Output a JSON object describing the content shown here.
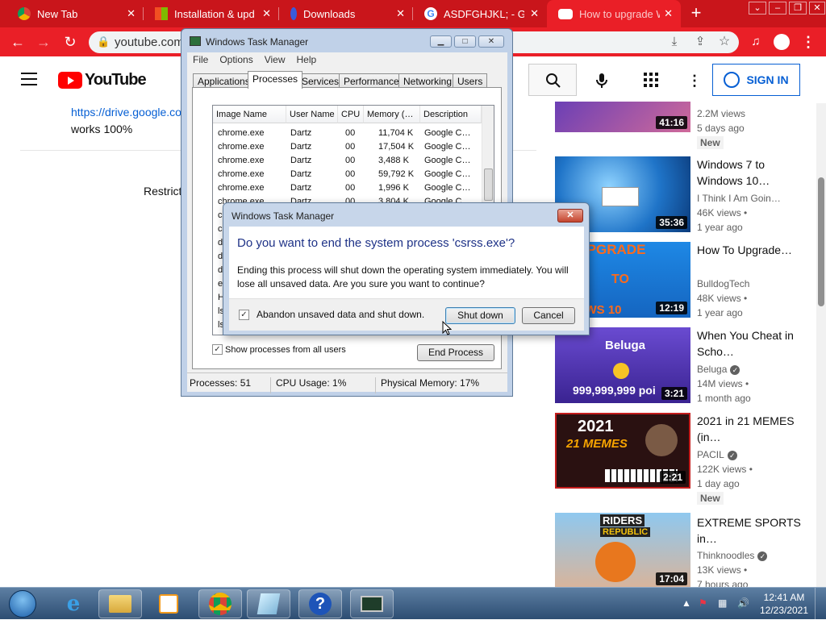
{
  "browser": {
    "tabs": [
      {
        "label": "New Tab",
        "favicon": "chrome-icon"
      },
      {
        "label": "Installation & upda",
        "favicon": "windows-icon"
      },
      {
        "label": "Downloads",
        "favicon": "downloads-icon"
      },
      {
        "label": "ASDFGHJKL; - Goo",
        "favicon": "google-icon"
      },
      {
        "label": "How to upgrade W",
        "favicon": "youtube-icon"
      }
    ],
    "url": "youtube.com/",
    "accent": "#ea1f27"
  },
  "youtube": {
    "logo": "YouTube",
    "sign_in": "SIGN IN",
    "description_link": "https://drive.google.co",
    "description_text": "works 100%",
    "restrict_text": "Restrict",
    "videos": [
      {
        "duration": "41:16",
        "title": "",
        "channel": "",
        "views": "2.2M views",
        "age": "5 days ago",
        "badge": "New"
      },
      {
        "duration": "35:36",
        "title": "Windows 7 to Windows 10…",
        "channel": "I Think I Am Goin…",
        "views": "46K views •",
        "age": "1 year ago"
      },
      {
        "duration": "12:19",
        "title": "How To Upgrade…",
        "channel": "BulldogTech",
        "views": "48K views •",
        "age": "1 year ago"
      },
      {
        "duration": "3:21",
        "title": "When You Cheat in Scho…",
        "channel": "Beluga",
        "views": "14M views •",
        "age": "1 month ago"
      },
      {
        "duration": "2:21",
        "title": "2021 in 21 MEMES (in…",
        "channel": "PACIL",
        "views": "122K views •",
        "age": "1 day ago",
        "badge": "New"
      },
      {
        "duration": "17:04",
        "title": "EXTREME SPORTS in…",
        "channel": "Thinknoodles",
        "views": "13K views •",
        "age": "7 hours ago"
      }
    ],
    "thumb_texts": {
      "t3a": "EE UPGRADE",
      "t3b": "TO",
      "t3c": "INDOWS 10",
      "t4a": "Beluga",
      "t4b": "999,999,999 poi",
      "t5a": "2021",
      "t5b": "21 MEMES",
      "t6a": "RIDERS",
      "t6b": "REPUBLIC"
    }
  },
  "task_manager": {
    "title": "Windows Task Manager",
    "menu": [
      "File",
      "Options",
      "View",
      "Help"
    ],
    "tabs": [
      "Applications",
      "Processes",
      "Services",
      "Performance",
      "Networking",
      "Users"
    ],
    "active_tab": "Processes",
    "columns": [
      "Image Name",
      "User Name",
      "CPU",
      "Memory (…",
      "Description"
    ],
    "rows": [
      {
        "name": "chrome.exe",
        "user": "Dartz",
        "cpu": "00",
        "mem": "11,704 K",
        "desc": "Google C…"
      },
      {
        "name": "chrome.exe",
        "user": "Dartz",
        "cpu": "00",
        "mem": "17,504 K",
        "desc": "Google C…"
      },
      {
        "name": "chrome.exe",
        "user": "Dartz",
        "cpu": "00",
        "mem": "3,488 K",
        "desc": "Google C…"
      },
      {
        "name": "chrome.exe",
        "user": "Dartz",
        "cpu": "00",
        "mem": "59,792 K",
        "desc": "Google C…"
      },
      {
        "name": "chrome.exe",
        "user": "Dartz",
        "cpu": "00",
        "mem": "1,996 K",
        "desc": "Google C…"
      },
      {
        "name": "chrome.exe",
        "user": "Dartz",
        "cpu": "00",
        "mem": "3,804 K",
        "desc": "Google C…"
      },
      {
        "name": "csr",
        "user": "",
        "cpu": "",
        "mem": "",
        "desc": ""
      },
      {
        "name": "csr",
        "user": "",
        "cpu": "",
        "mem": "",
        "desc": ""
      },
      {
        "name": "dllh",
        "user": "",
        "cpu": "",
        "mem": "",
        "desc": ""
      },
      {
        "name": "dllh",
        "user": "",
        "cpu": "",
        "mem": "",
        "desc": ""
      },
      {
        "name": "dw",
        "user": "",
        "cpu": "",
        "mem": "",
        "desc": ""
      },
      {
        "name": "ex",
        "user": "",
        "cpu": "",
        "mem": "",
        "desc": ""
      },
      {
        "name": "He",
        "user": "",
        "cpu": "",
        "mem": "",
        "desc": ""
      },
      {
        "name": "lsa",
        "user": "",
        "cpu": "",
        "mem": "",
        "desc": ""
      },
      {
        "name": "lsm",
        "user": "",
        "cpu": "",
        "mem": "",
        "desc": ""
      }
    ],
    "show_all_label": "Show processes from all users",
    "show_all_checked": true,
    "end_process": "End Process",
    "status": {
      "processes": "Processes: 51",
      "cpu": "CPU Usage: 1%",
      "memory": "Physical Memory: 17%"
    }
  },
  "dialog": {
    "title": "Windows Task Manager",
    "question": "Do you want to end the system process 'csrss.exe'?",
    "message": "Ending this process will shut down the operating system immediately.  You will lose all unsaved data.  Are you sure you want to continue?",
    "checkbox_label": "Abandon unsaved data and shut down.",
    "checkbox_checked": true,
    "shutdown": "Shut down",
    "cancel": "Cancel"
  },
  "taskbar": {
    "time": "12:41 AM",
    "date": "12/23/2021",
    "items": [
      "start-orb",
      "internet-explorer-icon",
      "file-explorer-icon",
      "media-player-icon",
      "chrome-icon",
      "notepad-icon",
      "help-icon",
      "task-manager-icon"
    ]
  }
}
